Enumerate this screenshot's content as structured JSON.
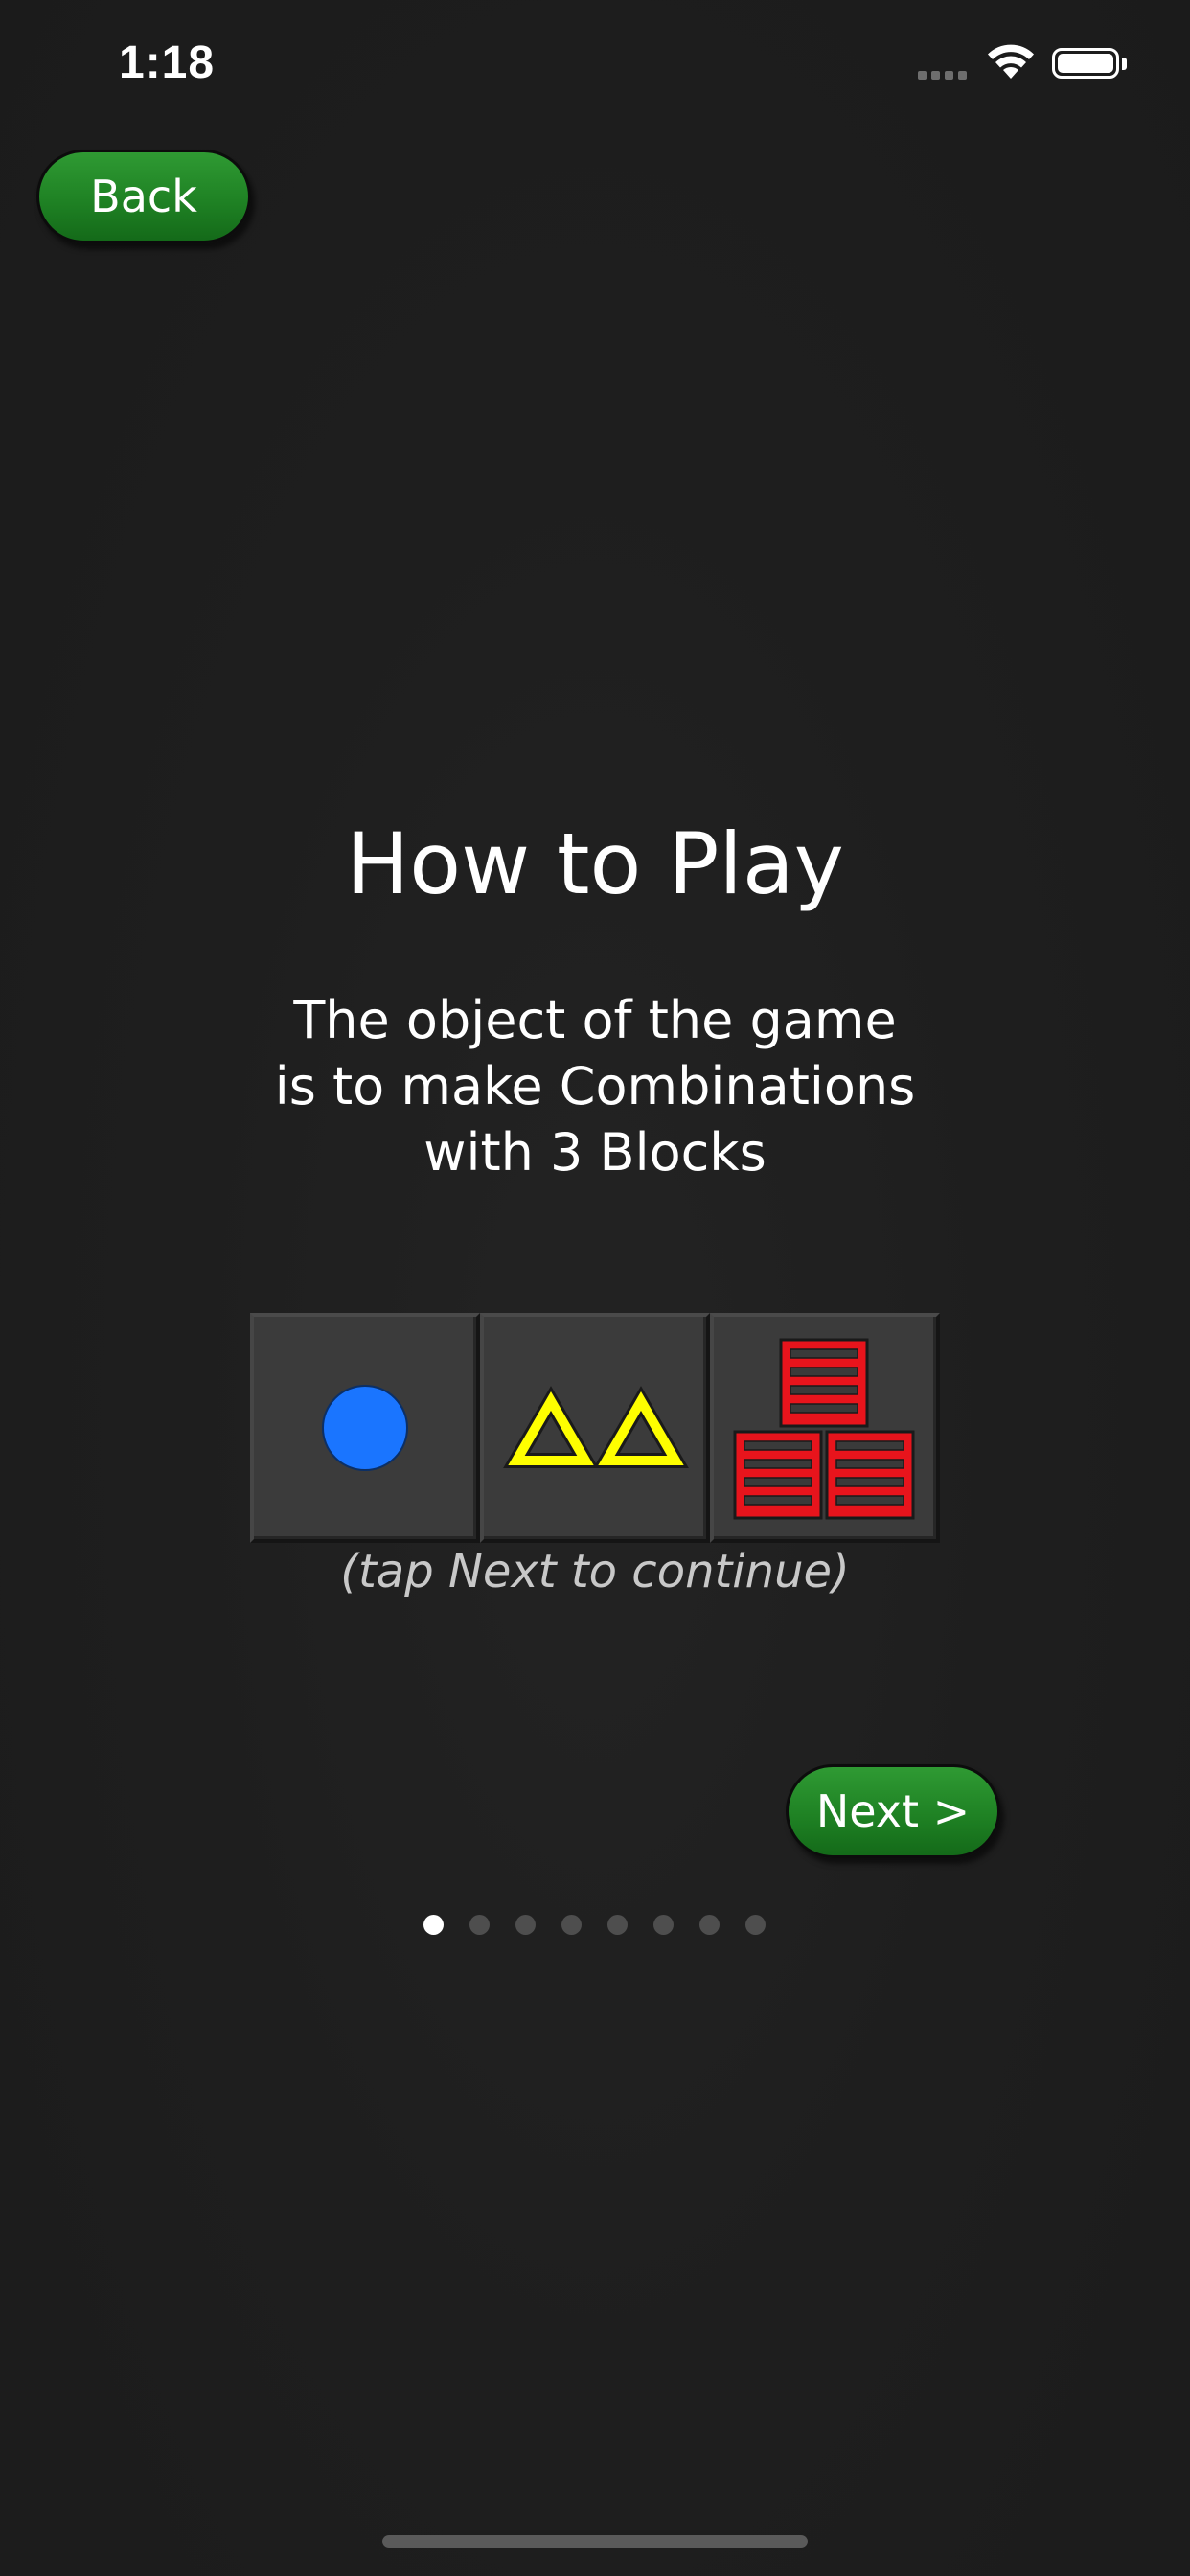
{
  "status_bar": {
    "time": "1:18",
    "icons": [
      "cellular-signal-icon",
      "wifi-icon",
      "battery-icon"
    ]
  },
  "nav": {
    "back_label": "Back"
  },
  "content": {
    "title": "How to Play",
    "subtitle_lines": [
      "The object of the game",
      "is to make Combinations",
      "with 3 Blocks"
    ],
    "hint": "(tap Next to continue)",
    "next_label": "Next >"
  },
  "blocks": [
    {
      "shape": "circle",
      "count": 1,
      "color": "#1a75ff"
    },
    {
      "shape": "triangle",
      "count": 2,
      "color": "#ffff00"
    },
    {
      "shape": "crate",
      "count": 3,
      "color": "#e8141c"
    }
  ],
  "pager": {
    "total": 8,
    "current": 1
  },
  "colors": {
    "button_green": "#1f8224",
    "background": "#1e1e1e"
  }
}
